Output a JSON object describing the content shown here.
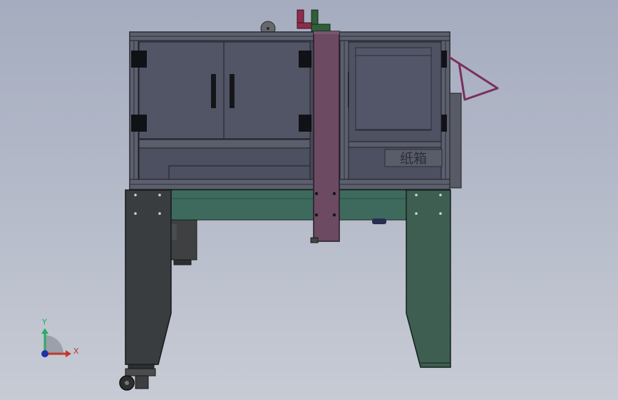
{
  "viewport": {
    "background_top": "#a5acbf",
    "background_bottom": "#c7cbd4"
  },
  "model": {
    "panel_label": "纸箱",
    "colors": {
      "frame": "#3f4150",
      "panel": "#525566",
      "leg_left": "#3a3d3f",
      "leg_right": "#3d5e50",
      "crossbeam": "#3d6a5c",
      "column": "#6b4a62",
      "handle": "#7a2f5c",
      "valve_red": "#8e2c4c",
      "valve_green": "#2f5f3a"
    }
  },
  "triad": {
    "x_label": "X",
    "y_label": "Y",
    "x_color": "#c0392b",
    "y_color": "#27ae60",
    "z_color": "#2130a8"
  }
}
